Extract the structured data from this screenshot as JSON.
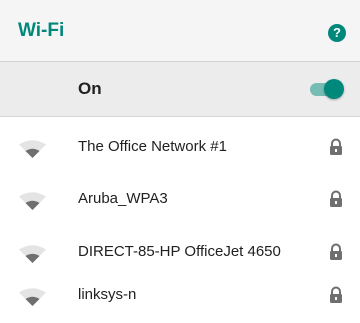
{
  "header": {
    "title": "Wi-Fi",
    "help_icon": "question-circle-icon",
    "help_glyph": "?"
  },
  "wifi_toggle": {
    "label": "On",
    "state": "on"
  },
  "networks": [
    {
      "ssid": "The Office Network #1",
      "secured": true
    },
    {
      "ssid": "Aruba_WPA3",
      "secured": true
    },
    {
      "ssid": "DIRECT-85-HP OfficeJet 4650",
      "secured": true
    },
    {
      "ssid": "linksys-n",
      "secured": true
    }
  ],
  "colors": {
    "accent": "#00897b",
    "icon_gray": "#6f6f6f",
    "header_bg": "#f5f5f5",
    "toggle_row_bg": "#ececec"
  }
}
